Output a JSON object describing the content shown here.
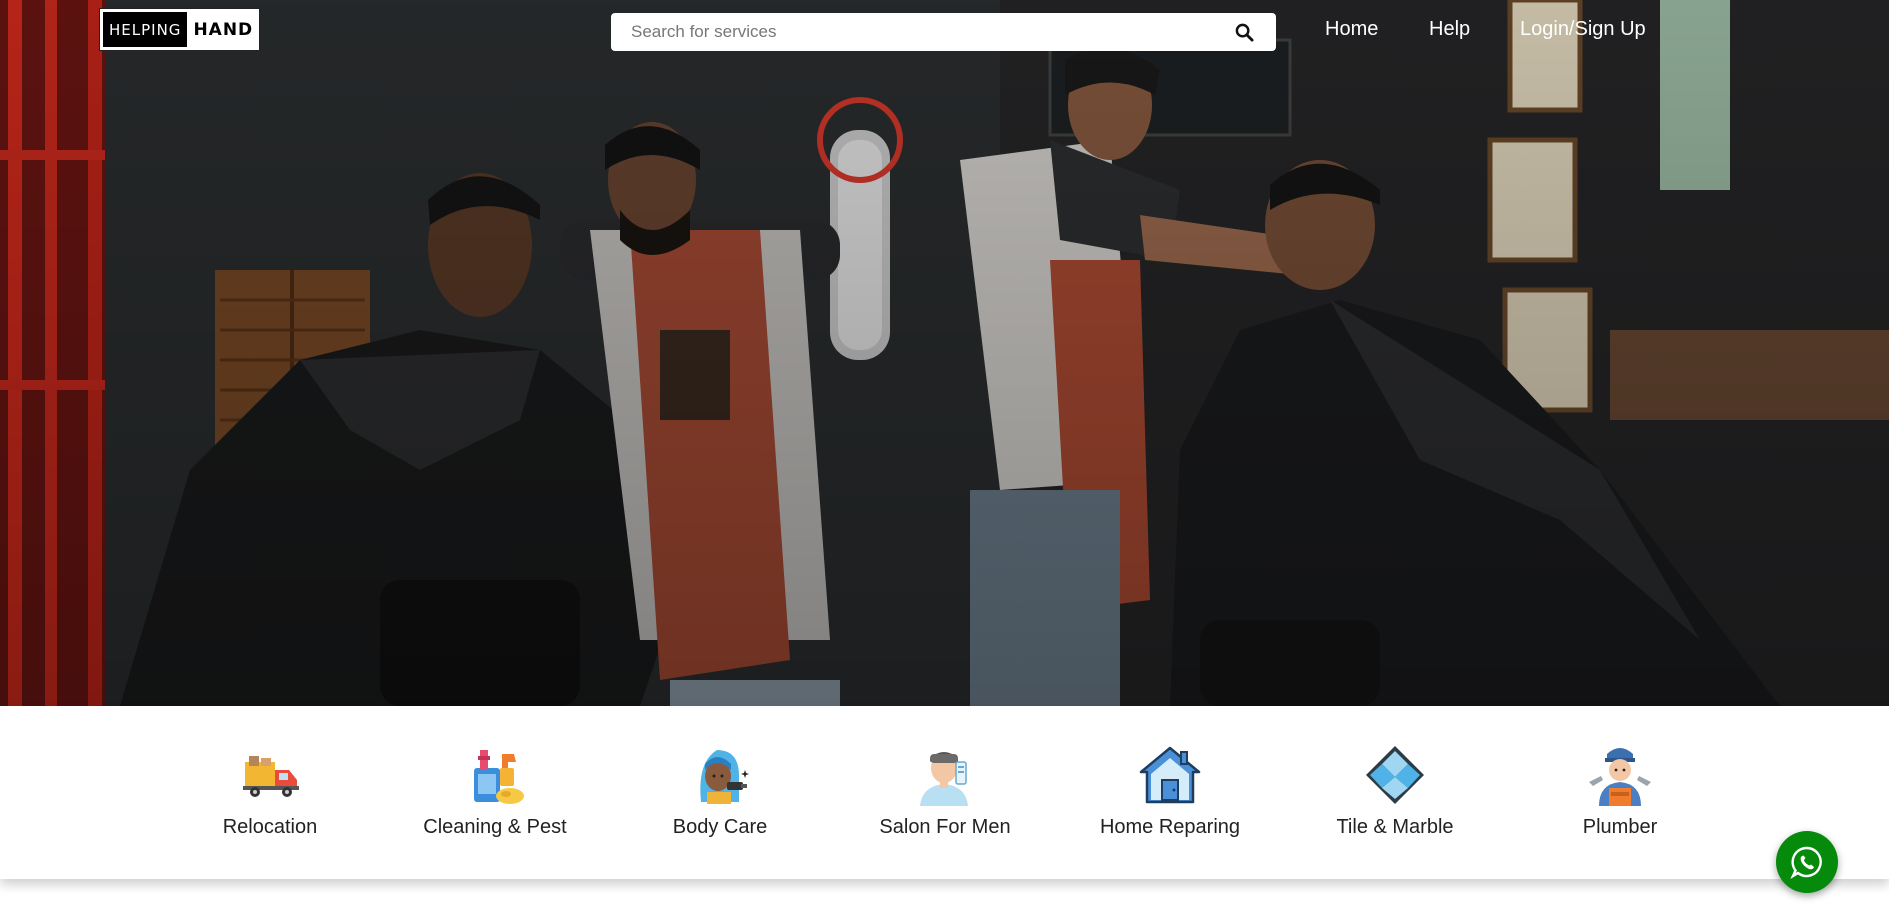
{
  "brand": {
    "left": "HELPING",
    "right": "HAND"
  },
  "search": {
    "placeholder": "Search for services"
  },
  "nav": [
    {
      "label": "Home"
    },
    {
      "label": "Help"
    },
    {
      "label": "Login/Sign Up"
    }
  ],
  "hero": {
    "image": "barbershop photo with two barbers cutting customers' hair"
  },
  "categories": [
    {
      "label": "Relocation",
      "icon": "moving-truck-icon"
    },
    {
      "label": "Cleaning & Pest",
      "icon": "cleaning-supplies-icon"
    },
    {
      "label": "Body Care",
      "icon": "body-care-icon"
    },
    {
      "label": "Salon For Men",
      "icon": "men-salon-icon"
    },
    {
      "label": "Home Reparing",
      "icon": "house-icon"
    },
    {
      "label": "Tile & Marble",
      "icon": "tile-icon"
    },
    {
      "label": "Plumber",
      "icon": "plumber-icon"
    }
  ],
  "colors": {
    "whatsapp": "#058a0b",
    "brand_black": "#000000"
  }
}
